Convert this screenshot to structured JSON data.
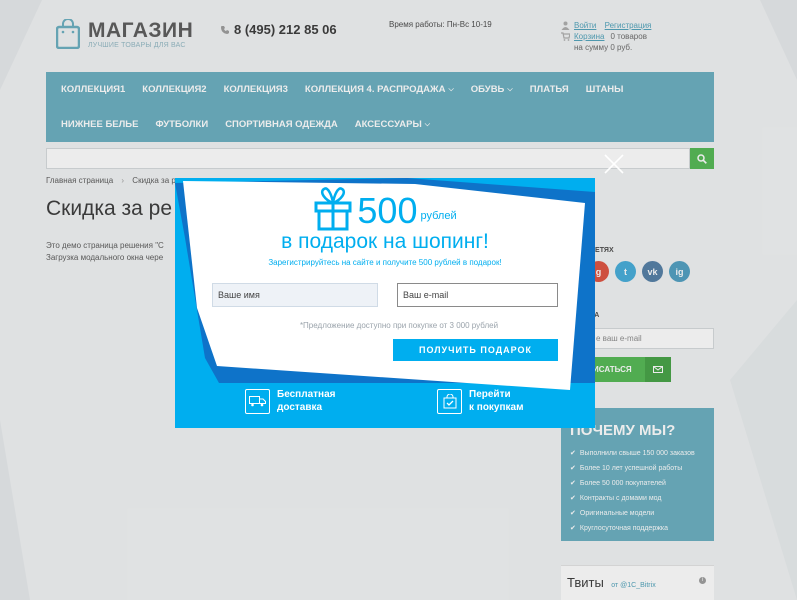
{
  "header": {
    "logo_title": "МАГАЗИН",
    "logo_subtitle": "ЛУЧШИЕ ТОВАРЫ ДЛЯ ВАС",
    "phone": "8 (495) 212 85 06",
    "hours": "Время работы: Пн-Вс 10-19",
    "login": "Войти",
    "register": "Регистрация",
    "cart_label": "Корзина",
    "cart_count": "0 товаров",
    "cart_sum": "на сумму 0 руб."
  },
  "nav": {
    "row1": [
      {
        "label": "КОЛЛЕКЦИЯ1",
        "chevron": ""
      },
      {
        "label": "КОЛЛЕКЦИЯ2",
        "chevron": ""
      },
      {
        "label": "КОЛЛЕКЦИЯ3",
        "chevron": ""
      },
      {
        "label": "КОЛЛЕКЦИЯ 4. РАСПРОДАЖА",
        "chevron": "⌵"
      },
      {
        "label": "ОБУВЬ",
        "chevron": "⌵"
      },
      {
        "label": "ПЛАТЬЯ",
        "chevron": ""
      },
      {
        "label": "ШТАНЫ",
        "chevron": ""
      }
    ],
    "row2": [
      {
        "label": "НИЖНЕЕ БЕЛЬЕ",
        "chevron": ""
      },
      {
        "label": "ФУТБОЛКИ",
        "chevron": ""
      },
      {
        "label": "СПОРТИВНАЯ ОДЕЖДА",
        "chevron": ""
      },
      {
        "label": "АКСЕССУАРЫ",
        "chevron": "⌵"
      }
    ]
  },
  "breadcrumb": {
    "home": "Главная страница",
    "sep": "›",
    "current": "Скидка за ре"
  },
  "content": {
    "title": "Скидка за ре",
    "line1": "Это демо страница решения \"С",
    "line2": "Загрузка модального окна чере"
  },
  "sidebar": {
    "social_title": "СЕТЯХ",
    "social": [
      {
        "letter": "g",
        "color": "#dd4b39"
      },
      {
        "letter": "t",
        "color": "#3fa9d8"
      },
      {
        "letter": "vk",
        "color": "#4e7aa3"
      },
      {
        "letter": "ig",
        "color": "#4a9cbf"
      }
    ],
    "subscribe_title": "КА",
    "email_placeholder": "е ваш e-mail",
    "subscribe_button": "ИСАТЬСЯ",
    "why_title": "ПОЧЕМУ МЫ?",
    "why_items": [
      "Выполнили свыше 150 000 заказов",
      "Более 10 лет успешной работы",
      "Более 50 000 покупателей",
      "Контракты с домами мод",
      "Оригинальные модели",
      "Круглосуточная поддержка"
    ],
    "tweets_title": "Твиты",
    "tweets_by": "от @1C_Bitrix",
    "tweets_info": "i"
  },
  "modal": {
    "amount": "500",
    "currency": "рублей",
    "headline": "в подарок на шопинг!",
    "subline": "Зарегистрируйтесь на сайте и получите 500 рублей в подарок!",
    "name_placeholder": "Ваше имя",
    "email_placeholder": "Ваш e-mail",
    "note": "*Предложение доступно при покупке от 3 000 рублей",
    "cta": "ПОЛУЧИТЬ ПОДАРОК",
    "feature1_line1": "Бесплатная",
    "feature1_line2": "доставка",
    "feature2_line1": "Перейти",
    "feature2_line2": "к покупкам"
  },
  "colors": {
    "accent": "#64acbe",
    "modal": "#00aeef",
    "green": "#4db64d"
  }
}
